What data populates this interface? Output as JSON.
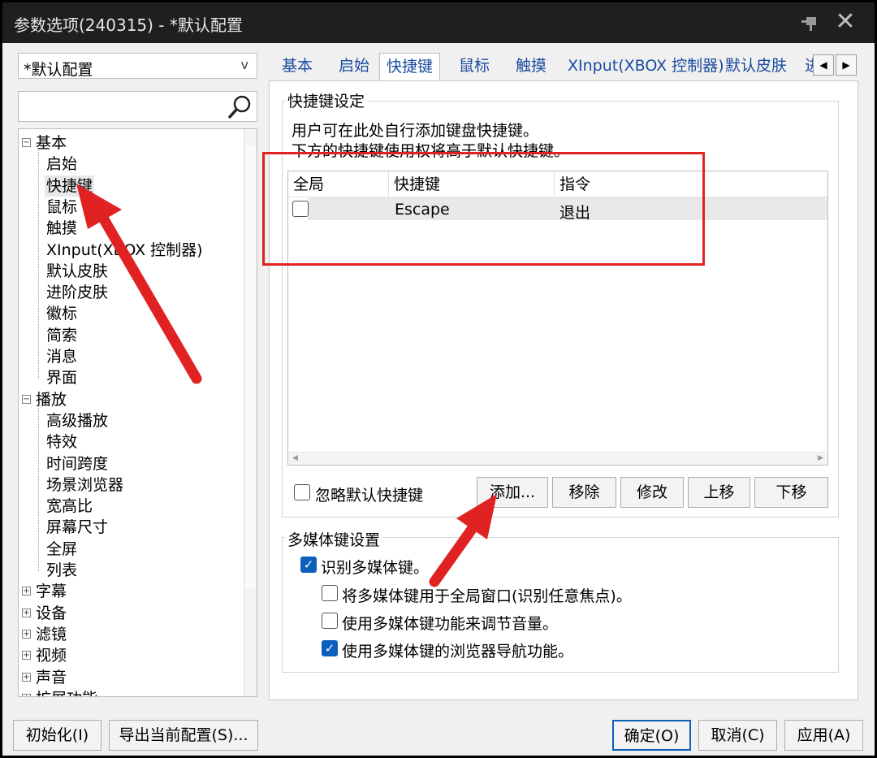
{
  "window": {
    "title": "参数选项(240315) - *默认配置"
  },
  "profile": {
    "selected": "*默认配置",
    "arrow": "v"
  },
  "search": {
    "placeholder": ""
  },
  "tree": [
    {
      "label": "基本",
      "type": "group",
      "expanded": true
    },
    {
      "label": "启始"
    },
    {
      "label": "快捷键",
      "selected": true
    },
    {
      "label": "鼠标"
    },
    {
      "label": "触摸"
    },
    {
      "label": "XInput(XBOX 控制器)"
    },
    {
      "label": "默认皮肤"
    },
    {
      "label": "进阶皮肤"
    },
    {
      "label": "徽标"
    },
    {
      "label": "简索"
    },
    {
      "label": "消息"
    },
    {
      "label": "界面"
    },
    {
      "label": "播放",
      "type": "group",
      "expanded": true
    },
    {
      "label": "高级播放"
    },
    {
      "label": "特效"
    },
    {
      "label": "时间跨度"
    },
    {
      "label": "场景浏览器"
    },
    {
      "label": "宽高比"
    },
    {
      "label": "屏幕尺寸"
    },
    {
      "label": "全屏"
    },
    {
      "label": "列表"
    },
    {
      "label": "字幕",
      "type": "group",
      "expanded": false
    },
    {
      "label": "设备",
      "type": "group",
      "expanded": false
    },
    {
      "label": "滤镜",
      "type": "group",
      "expanded": false
    },
    {
      "label": "视频",
      "type": "group",
      "expanded": false
    },
    {
      "label": "声音",
      "type": "group",
      "expanded": false
    },
    {
      "label": "扩展功能",
      "type": "group",
      "expanded": false
    }
  ],
  "tabs": [
    "基本",
    "启始",
    "快捷键",
    "鼠标",
    "触摸",
    "XInput(XBOX 控制器)",
    "默认皮肤",
    "进"
  ],
  "active_tab": "快捷键",
  "hotkey_group": {
    "label": "快捷键设定",
    "desc1": "用户可在此处自行添加键盘快捷键。",
    "desc2": "下方的快捷键使用权将高于默认快捷键。",
    "columns": [
      "全局",
      "快捷键",
      "指令"
    ],
    "rows": [
      {
        "global": false,
        "key": "Escape",
        "command": "退出"
      }
    ],
    "ignore_default": "忽略默认快捷键",
    "buttons": {
      "add": "添加...",
      "remove": "移除",
      "modify": "修改",
      "up": "上移",
      "down": "下移"
    }
  },
  "media_group": {
    "label": "多媒体键设置",
    "recognize": "识别多媒体键。",
    "global": "将多媒体键用于全局窗口(识别任意焦点)。",
    "volume": "使用多媒体键功能来调节音量。",
    "browser": "使用多媒体键的浏览器导航功能。",
    "recognize_checked": true,
    "global_checked": false,
    "volume_checked": false,
    "browser_checked": true
  },
  "footer": {
    "init": "初始化(I)",
    "export": "导出当前配置(S)...",
    "ok": "确定(O)",
    "cancel": "取消(C)",
    "apply": "应用(A)"
  },
  "colors": {
    "title_bg": "#1f1f1f",
    "tab_text": "#1a4b9e",
    "check": "#0b5fbd",
    "annotation": "#e02222"
  }
}
